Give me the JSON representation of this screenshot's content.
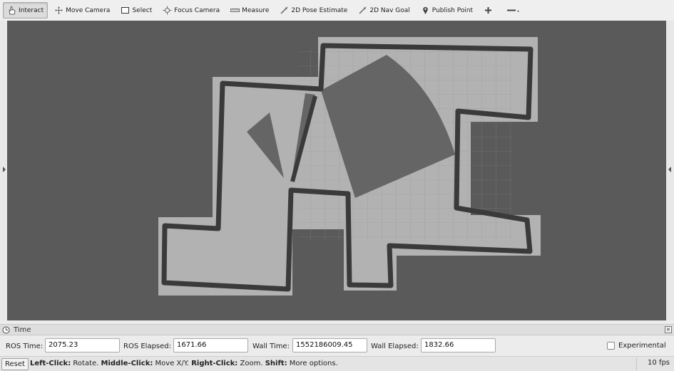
{
  "toolbar": {
    "tools": [
      {
        "id": "interact",
        "label": "Interact",
        "icon": "hand-pointer-icon",
        "active": true
      },
      {
        "id": "move-camera",
        "label": "Move Camera",
        "icon": "move-camera-icon",
        "active": false
      },
      {
        "id": "select",
        "label": "Select",
        "icon": "select-box-icon",
        "active": false
      },
      {
        "id": "focus-camera",
        "label": "Focus Camera",
        "icon": "focus-camera-icon",
        "active": false
      },
      {
        "id": "measure",
        "label": "Measure",
        "icon": "ruler-icon",
        "active": false
      },
      {
        "id": "pose-estimate",
        "label": "2D Pose Estimate",
        "icon": "pose-arrow-icon",
        "active": false
      },
      {
        "id": "nav-goal",
        "label": "2D Nav Goal",
        "icon": "nav-goal-arrow-icon",
        "active": false
      },
      {
        "id": "publish-point",
        "label": "Publish Point",
        "icon": "map-pin-icon",
        "active": false
      }
    ],
    "extra_icons": [
      "add-tool-icon",
      "more-tools-icon"
    ]
  },
  "time_panel": {
    "title": "Time",
    "ros_time_label": "ROS Time:",
    "ros_time": "2075.23",
    "ros_elapsed_label": "ROS Elapsed:",
    "ros_elapsed": "1671.66",
    "wall_time_label": "Wall Time:",
    "wall_time": "1552186009.45",
    "wall_elapsed_label": "Wall Elapsed:",
    "wall_elapsed": "1832.66",
    "experimental_label": "Experimental",
    "experimental_checked": false
  },
  "status": {
    "reset_label": "Reset",
    "left_click_key": "Left-Click:",
    "left_click_action": "Rotate.",
    "middle_click_key": "Middle-Click:",
    "middle_click_action": "Move X/Y.",
    "right_click_key": "Right-Click:",
    "right_click_action": "Zoom.",
    "shift_key": "Shift:",
    "shift_action": "More options.",
    "fps": "10 fps"
  },
  "colors": {
    "viewport_bg": "#5a5a5a",
    "map_free": "#b0b0b0",
    "map_walls": "#3c3c3c",
    "map_scan": "#6a6a6a",
    "grid": "#8f8f8f"
  }
}
